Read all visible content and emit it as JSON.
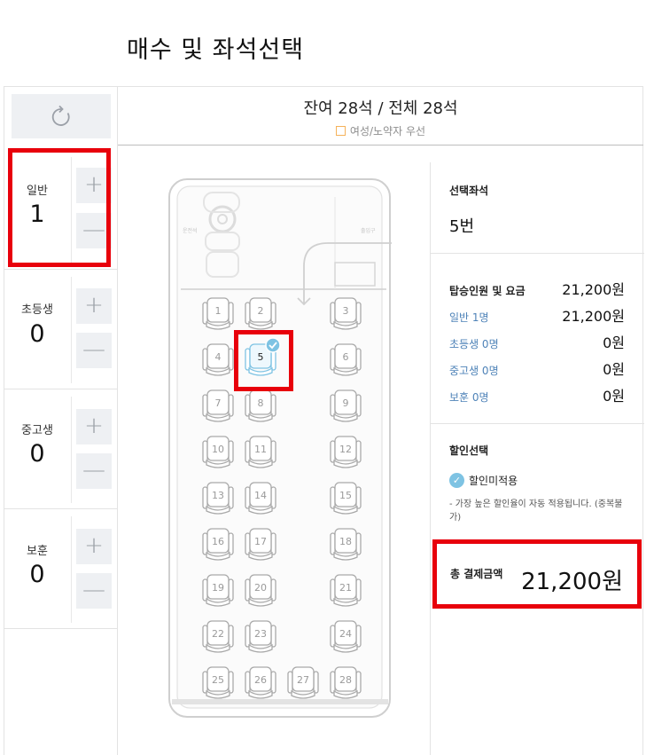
{
  "page_title": "매수 및 좌석선택",
  "counters": [
    {
      "label": "일반",
      "value": "1"
    },
    {
      "label": "초등생",
      "value": "0"
    },
    {
      "label": "중고생",
      "value": "0"
    },
    {
      "label": "보훈",
      "value": "0"
    }
  ],
  "stepper": {
    "plus": "+",
    "minus": "—"
  },
  "summary": {
    "remaining": "잔여 28석 / 전체 28석",
    "legend_women": "여성/노약자 우선"
  },
  "bus": {
    "driver_label": "운전석",
    "door_label": "출입구"
  },
  "seats": [
    "1",
    "2",
    "3",
    "4",
    "5",
    "6",
    "7",
    "8",
    "9",
    "10",
    "11",
    "12",
    "13",
    "14",
    "15",
    "16",
    "17",
    "18",
    "19",
    "20",
    "21",
    "22",
    "23",
    "24",
    "25",
    "26",
    "27",
    "28"
  ],
  "selected_seat_number": "5",
  "selected": {
    "title": "선택좌석",
    "value": "5번"
  },
  "fare": {
    "title": "탑승인원 및 요금",
    "total": "21,200원",
    "rows": [
      {
        "label": "일반 1명",
        "value": "21,200원"
      },
      {
        "label": "초등생 0명",
        "value": "0원"
      },
      {
        "label": "중고생 0명",
        "value": "0원"
      },
      {
        "label": "보훈 0명",
        "value": "0원"
      }
    ]
  },
  "discount": {
    "title": "할인선택",
    "option": "할인미적용",
    "note": "- 가장 높은 할인율이 자동 적용됩니다. (중복불가)"
  },
  "total": {
    "label": "총 결제금액",
    "value": "21,200원"
  },
  "colors": {
    "accent_red": "#e8000b",
    "selected_seat": "#7ec3e3",
    "link_blue": "#4f83b8",
    "women_priority": "#f5b25a"
  }
}
